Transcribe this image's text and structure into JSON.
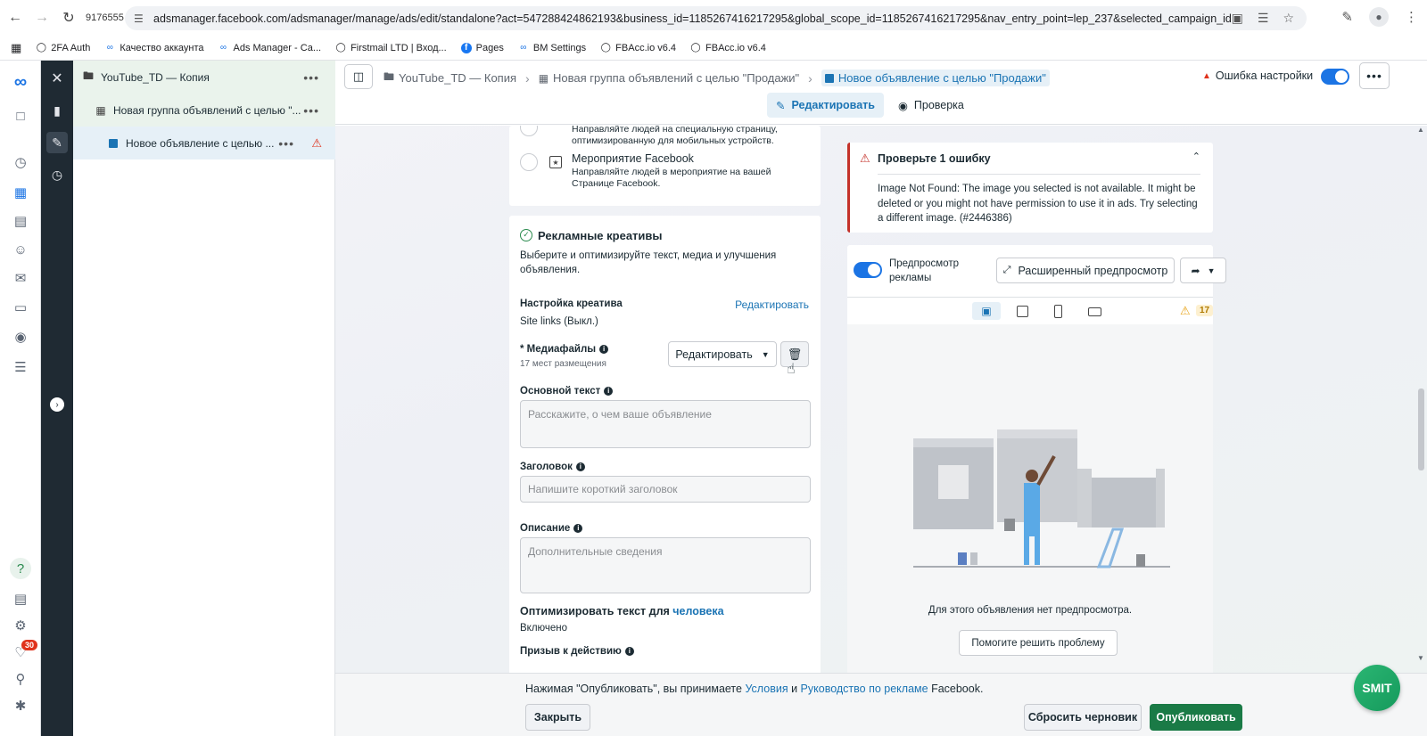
{
  "browser": {
    "tab_number": "9176555",
    "url": "adsmanager.facebook.com/adsmanager/manage/ads/edit/standalone?act=547288424862193&business_id=1185267416217295&global_scope_id=1185267416217295&nav_entry_point=lep_237&selected_campaign_ids=2384669434256...",
    "bookmarks": [
      {
        "label": "2FA Auth",
        "icon": "globe-icon"
      },
      {
        "label": "Качество аккаунта",
        "icon": "meta-icon"
      },
      {
        "label": "Ads Manager - Са...",
        "icon": "meta-icon"
      },
      {
        "label": "Firstmail LTD | Вход...",
        "icon": "globe-icon"
      },
      {
        "label": "Pages",
        "icon": "facebook-icon"
      },
      {
        "label": "BM Settings",
        "icon": "meta-icon"
      },
      {
        "label": "FBAcc.io v6.4",
        "icon": "globe-icon"
      },
      {
        "label": "FBAcc.io v6.4",
        "icon": "globe-icon"
      }
    ]
  },
  "rail": {
    "notifications_badge": "30"
  },
  "tree": {
    "campaign": "YouTube_TD — Копия",
    "adset": "Новая группа объявлений с целью \"...",
    "ad": "Новое объявление с целью ..."
  },
  "header": {
    "crumbs": [
      "YouTube_TD — Копия",
      "Новая группа объявлений с целью \"Продажи\"",
      "Новое объявление с целью \"Продажи\""
    ],
    "error_status": "Ошибка настройки",
    "tab_edit": "Редактировать",
    "tab_review": "Проверка"
  },
  "destination_card": {
    "opt1_desc": "Направляйте людей на специальную страницу, оптимизированную для мобильных устройств.",
    "opt2_title": "Мероприятие Facebook",
    "opt2_desc": "Направляйте людей в мероприятие на вашей Странице Facebook."
  },
  "creative": {
    "title": "Рекламные креативы",
    "subtitle": "Выберите и оптимизируйте текст, медиа и улучшения объявления.",
    "setup_label": "Настройка креатива",
    "setup_edit": "Редактировать",
    "site_links": "Site links (Выкл.)",
    "media_label": "* Медиафайлы",
    "media_sub": "17 мест размещения",
    "media_edit_btn": "Редактировать",
    "primary_text_label": "Основной текст",
    "primary_text_placeholder": "Расскажите, о чем ваше объявление",
    "headline_label": "Заголовок",
    "headline_placeholder": "Напишите короткий заголовок",
    "description_label": "Описание",
    "description_placeholder": "Дополнительные сведения",
    "optimize_text": "Оптимизировать текст для",
    "optimize_link": "человека",
    "optimize_value": "Включено",
    "cta_label": "Призыв к действию"
  },
  "error_box": {
    "title": "Проверьте 1 ошибку",
    "message": "Image Not Found: The image you selected is not available. It might be deleted or you might not have permission to use it in ads. Try selecting a different image. (#2446386)"
  },
  "preview": {
    "toggle_label": "Предпросмотр рекламы",
    "advanced_btn": "Расширенный предпросмотр",
    "warning_count": "17",
    "empty_text": "Для этого объявления нет предпросмотра.",
    "help_btn": "Помогите решить проблему"
  },
  "footer": {
    "text_before": "Нажимая \"Опубликовать\", вы принимаете",
    "link1": "Условия",
    "and": "и",
    "link2": "Руководство по рекламе",
    "text_after": "Facebook.",
    "close_btn": "Закрыть",
    "reset_btn": "Сбросить черновик",
    "publish_btn": "Опубликовать"
  },
  "watermark": "SMIT",
  "colors": {
    "accent_blue": "#1b74b4",
    "publish_green": "#1a7a46",
    "error_red": "#e0321c",
    "warning_orange": "#f7b928"
  }
}
